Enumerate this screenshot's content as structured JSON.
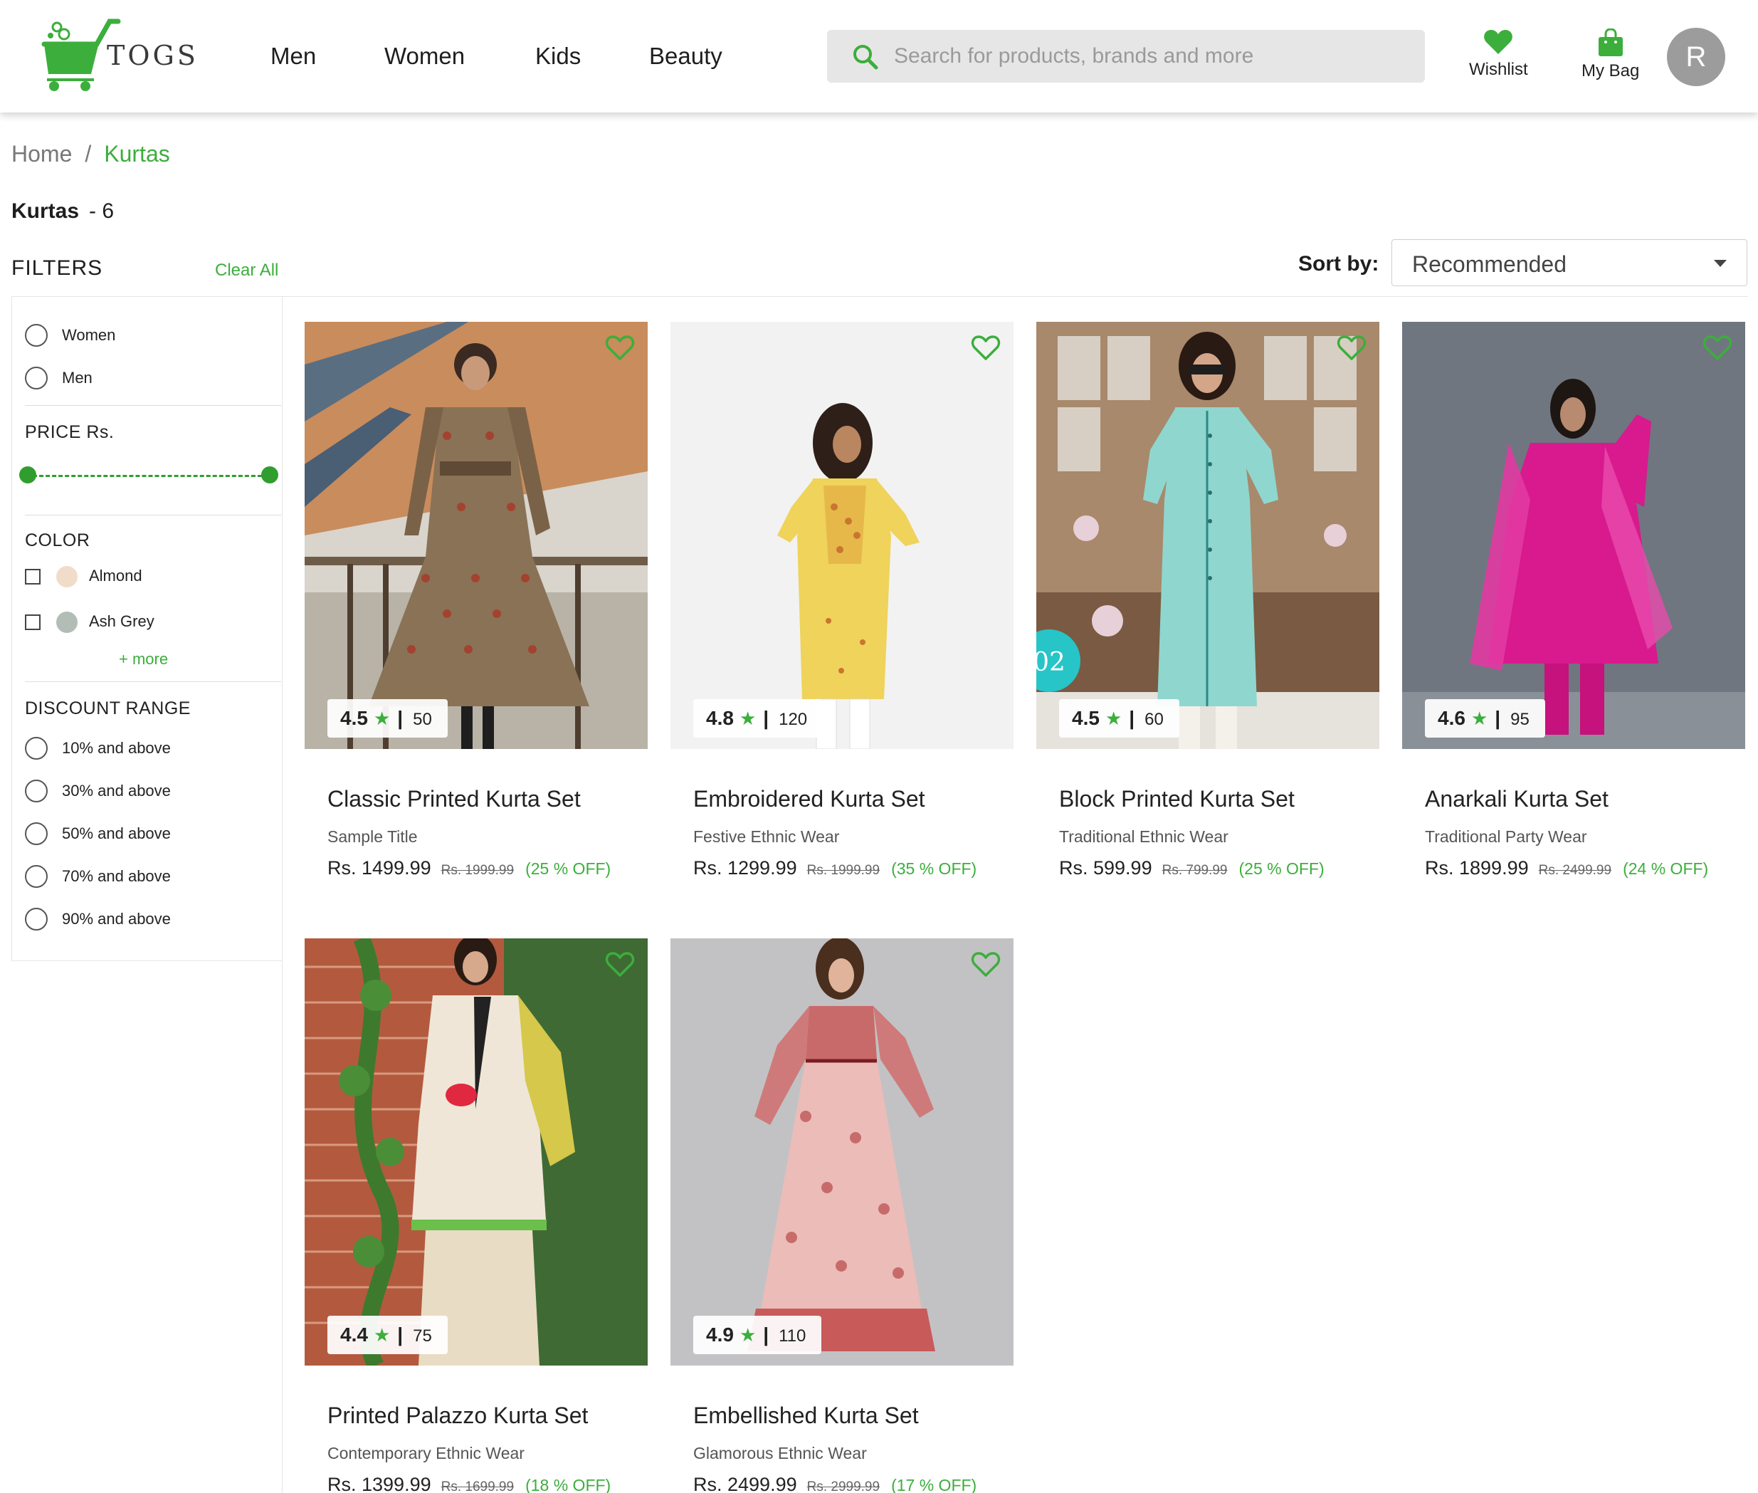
{
  "header": {
    "logo_text": "TOGS",
    "nav": [
      "Men",
      "Women",
      "Kids",
      "Beauty"
    ],
    "search_placeholder": "Search for products, brands and more",
    "wishlist_label": "Wishlist",
    "bag_label": "My Bag",
    "avatar_initial": "R",
    "brand_color": "#3cae3c"
  },
  "breadcrumb": {
    "home": "Home",
    "sep": "/",
    "current": "Kurtas"
  },
  "page": {
    "title": "Kurtas",
    "count": "- 6"
  },
  "filters": {
    "title": "FILTERS",
    "clear_all": "Clear All",
    "gender": [
      "Women",
      "Men"
    ],
    "price_title": "PRICE Rs.",
    "color_title": "COLOR",
    "colors": [
      {
        "name": "Almond",
        "hex": "#f0dcc8"
      },
      {
        "name": "Ash Grey",
        "hex": "#b2bdb6"
      }
    ],
    "more": "+ more",
    "discount_title": "DISCOUNT RANGE",
    "discounts": [
      "10% and above",
      "30% and above",
      "50% and above",
      "70% and above",
      "90% and above"
    ]
  },
  "sort": {
    "label": "Sort by:",
    "value": "Recommended"
  },
  "products": [
    {
      "name": "Classic Printed Kurta Set",
      "subtitle": "Sample Title",
      "price": "Rs. 1499.99",
      "mrp": "Rs. 1999.99",
      "discount": "(25 % OFF)",
      "rating": "4.5",
      "rating_count": "50",
      "image": "woman in brown printed anarkali kurta on staircase"
    },
    {
      "name": "Embroidered Kurta Set",
      "subtitle": "Festive Ethnic Wear",
      "price": "Rs. 1299.99",
      "mrp": "Rs. 1999.99",
      "discount": "(35 % OFF)",
      "rating": "4.8",
      "rating_count": "120",
      "image": "woman in yellow embroidered kurta"
    },
    {
      "name": "Block Printed Kurta Set",
      "subtitle": "Traditional Ethnic Wear",
      "price": "Rs. 599.99",
      "mrp": "Rs. 799.99",
      "discount": "(25 % OFF)",
      "rating": "4.5",
      "rating_count": "60",
      "image": "woman in mint block printed kurta",
      "badge": "02"
    },
    {
      "name": "Anarkali Kurta Set",
      "subtitle": "Traditional Party Wear",
      "price": "Rs. 1899.99",
      "mrp": "Rs. 2499.99",
      "discount": "(24 % OFF)",
      "rating": "4.6",
      "rating_count": "95",
      "image": "woman in magenta anarkali with dupatta"
    },
    {
      "name": "Printed Palazzo Kurta Set",
      "subtitle": "Contemporary Ethnic Wear",
      "price": "Rs. 1399.99",
      "mrp": "Rs. 1699.99",
      "discount": "(18 % OFF)",
      "rating": "4.4",
      "rating_count": "75",
      "image": "woman in cream lace kurta with dhoti pants"
    },
    {
      "name": "Embellished Kurta Set",
      "subtitle": "Glamorous Ethnic Wear",
      "price": "Rs. 2499.99",
      "mrp": "Rs. 2999.99",
      "discount": "(17 % OFF)",
      "rating": "4.9",
      "rating_count": "110",
      "image": "woman in pink printed flared kurta"
    }
  ]
}
